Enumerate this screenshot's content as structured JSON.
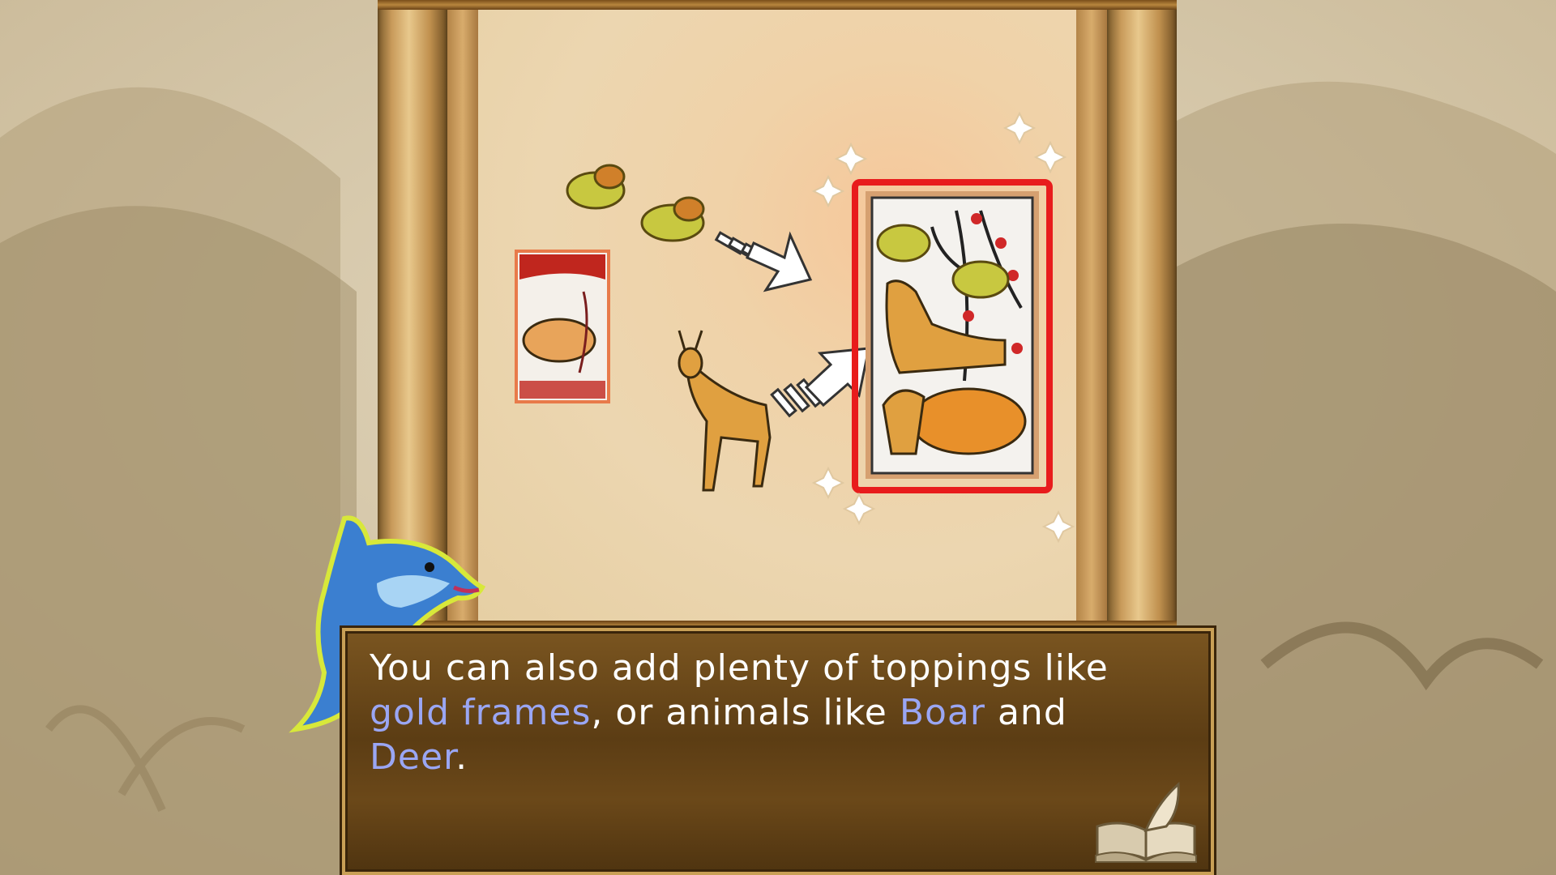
{
  "dialog": {
    "line1": "You can also add plenty of toppings like",
    "line2_highlight1": "gold frames",
    "line2_plain": ", or animals like ",
    "line2_highlight2": "Boar",
    "line2_end": " and",
    "line3_highlight": "Deer",
    "line3_end": "."
  },
  "colors": {
    "text": "#ffffff",
    "highlight": "#9aa6f4",
    "card_frame": "#e81c1c",
    "dialog_border": "#c9a056"
  },
  "icons": {
    "book": "open-book-icon",
    "guide": "dolphin-mascot"
  }
}
